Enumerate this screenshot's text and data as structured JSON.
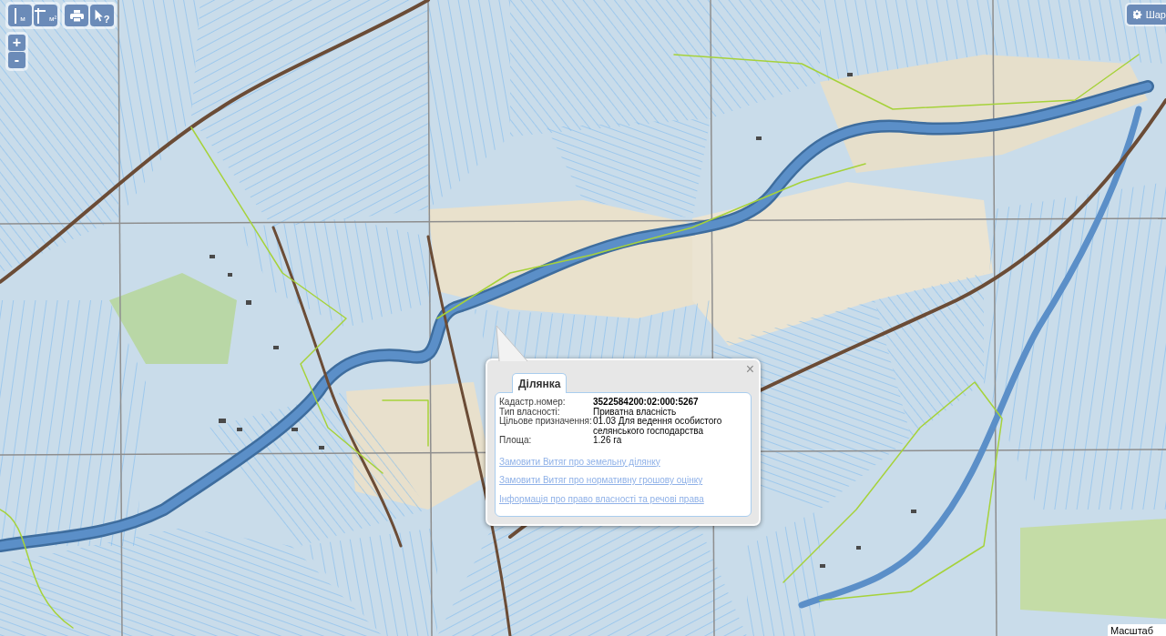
{
  "toolbar": {
    "groups": [
      {
        "buttons": [
          {
            "kind": "length",
            "label": "м"
          },
          {
            "kind": "area",
            "label": "м²"
          }
        ]
      },
      {
        "buttons": [
          {
            "kind": "print"
          },
          {
            "kind": "identify",
            "label": "?"
          }
        ]
      }
    ]
  },
  "zoom_buttons": [
    "+",
    "-"
  ],
  "layers_button": {
    "label": "Шар"
  },
  "popup": {
    "close": "×",
    "tabs": [
      {
        "label": "Ділянка",
        "selected": true
      }
    ],
    "fields": [
      {
        "label": "Кадастр.номер:",
        "value": "3522584200:02:000:5267",
        "bold": true
      },
      {
        "label": "Тип власності:",
        "value": "Приватна власність",
        "bold": false
      },
      {
        "label": "Цільове призначення:",
        "value": "01.03 Для ведення особистого селянського господарства",
        "bold": false
      },
      {
        "label": "Площа:",
        "value": "1.26 га",
        "bold": false
      }
    ],
    "links": [
      "Замовити Витяг про земельну ділянку",
      "Замовити Витяг про нормативну грошову оцінку",
      "Інформація про право власності та речові права"
    ]
  },
  "scale": {
    "label": "Масштаб"
  }
}
